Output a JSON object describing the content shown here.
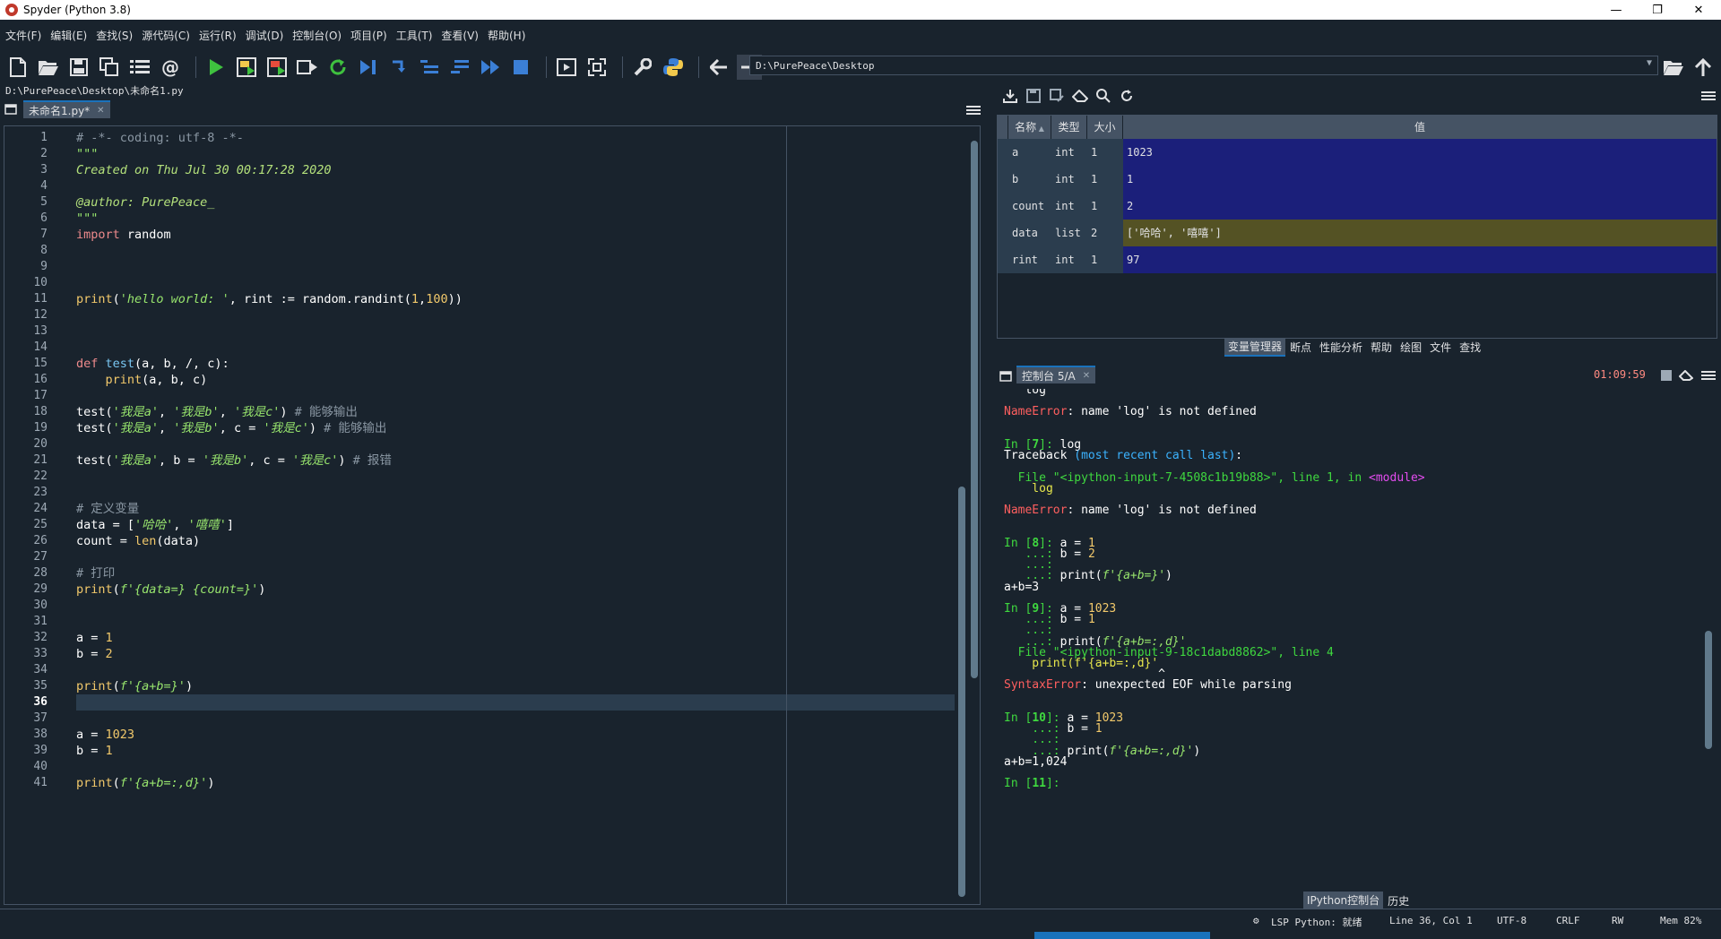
{
  "window": {
    "title": "Spyder (Python 3.8)"
  },
  "menu": [
    "文件(F)",
    "编辑(E)",
    "查找(S)",
    "源代码(C)",
    "运行(R)",
    "调试(D)",
    "控制台(O)",
    "项目(P)",
    "工具(T)",
    "查看(V)",
    "帮助(H)"
  ],
  "toolbar": {
    "path": "D:\\PurePeace\\Desktop"
  },
  "editor": {
    "file_path": "D:\\PurePeace\\Desktop\\未命名1.py",
    "tab_label": "未命名1.py*",
    "current_line": 36,
    "lines": [
      [
        {
          "t": "# -*- coding: utf-8 -*-",
          "c": "comment"
        }
      ],
      [
        {
          "t": "\"\"\"",
          "c": "str"
        }
      ],
      [
        {
          "t": "Created on Thu Jul 30 00:17:28 2020",
          "c": "doc"
        }
      ],
      [],
      [
        {
          "t": "@author: PurePeace_",
          "c": "doc"
        }
      ],
      [
        {
          "t": "\"\"\"",
          "c": "str"
        }
      ],
      [
        {
          "t": "import",
          "c": "kw"
        },
        {
          "t": " random",
          "c": "plain"
        }
      ],
      [],
      [],
      [],
      [
        {
          "t": "print",
          "c": "builtin"
        },
        {
          "t": "(",
          "c": "plain"
        },
        {
          "t": "'hello world: '",
          "c": "str"
        },
        {
          "t": ", rint := random.randint(",
          "c": "plain"
        },
        {
          "t": "1",
          "c": "num"
        },
        {
          "t": ",",
          "c": "plain"
        },
        {
          "t": "100",
          "c": "num"
        },
        {
          "t": "))",
          "c": "plain"
        }
      ],
      [],
      [],
      [],
      [
        {
          "t": "def ",
          "c": "kw"
        },
        {
          "t": "test",
          "c": "def"
        },
        {
          "t": "(a, b, /, c):",
          "c": "plain"
        }
      ],
      [
        {
          "t": "    ",
          "c": "plain"
        },
        {
          "t": "print",
          "c": "builtin"
        },
        {
          "t": "(a, b, c)",
          "c": "plain"
        }
      ],
      [],
      [
        {
          "t": "test(",
          "c": "plain"
        },
        {
          "t": "'我是a'",
          "c": "str"
        },
        {
          "t": ", ",
          "c": "plain"
        },
        {
          "t": "'我是b'",
          "c": "str"
        },
        {
          "t": ", ",
          "c": "plain"
        },
        {
          "t": "'我是c'",
          "c": "str"
        },
        {
          "t": ") ",
          "c": "plain"
        },
        {
          "t": "# 能够输出",
          "c": "comment"
        }
      ],
      [
        {
          "t": "test(",
          "c": "plain"
        },
        {
          "t": "'我是a'",
          "c": "str"
        },
        {
          "t": ", ",
          "c": "plain"
        },
        {
          "t": "'我是b'",
          "c": "str"
        },
        {
          "t": ", c = ",
          "c": "plain"
        },
        {
          "t": "'我是c'",
          "c": "str"
        },
        {
          "t": ") ",
          "c": "plain"
        },
        {
          "t": "# 能够输出",
          "c": "comment"
        }
      ],
      [],
      [
        {
          "t": "test(",
          "c": "plain"
        },
        {
          "t": "'我是a'",
          "c": "str"
        },
        {
          "t": ", b = ",
          "c": "plain"
        },
        {
          "t": "'我是b'",
          "c": "str"
        },
        {
          "t": ", c = ",
          "c": "plain"
        },
        {
          "t": "'我是c'",
          "c": "str"
        },
        {
          "t": ") ",
          "c": "plain"
        },
        {
          "t": "# 报错",
          "c": "comment"
        }
      ],
      [],
      [],
      [
        {
          "t": "# 定义变量",
          "c": "comment"
        }
      ],
      [
        {
          "t": "data = [",
          "c": "plain"
        },
        {
          "t": "'哈哈'",
          "c": "str"
        },
        {
          "t": ", ",
          "c": "plain"
        },
        {
          "t": "'嘻嘻'",
          "c": "str"
        },
        {
          "t": "]",
          "c": "plain"
        }
      ],
      [
        {
          "t": "count = ",
          "c": "plain"
        },
        {
          "t": "len",
          "c": "builtin"
        },
        {
          "t": "(data)",
          "c": "plain"
        }
      ],
      [],
      [
        {
          "t": "# 打印",
          "c": "comment"
        }
      ],
      [
        {
          "t": "print",
          "c": "builtin"
        },
        {
          "t": "(",
          "c": "plain"
        },
        {
          "t": "f'{data=} {count=}'",
          "c": "str"
        },
        {
          "t": ")",
          "c": "plain"
        }
      ],
      [],
      [],
      [
        {
          "t": "a = ",
          "c": "plain"
        },
        {
          "t": "1",
          "c": "num"
        }
      ],
      [
        {
          "t": "b = ",
          "c": "plain"
        },
        {
          "t": "2",
          "c": "num"
        }
      ],
      [],
      [
        {
          "t": "print",
          "c": "builtin"
        },
        {
          "t": "(",
          "c": "plain"
        },
        {
          "t": "f'{a+b=}'",
          "c": "str"
        },
        {
          "t": ")",
          "c": "plain"
        }
      ],
      [],
      [],
      [
        {
          "t": "a = ",
          "c": "plain"
        },
        {
          "t": "1023",
          "c": "num"
        }
      ],
      [
        {
          "t": "b = ",
          "c": "plain"
        },
        {
          "t": "1",
          "c": "num"
        }
      ],
      [],
      [
        {
          "t": "print",
          "c": "builtin"
        },
        {
          "t": "(",
          "c": "plain"
        },
        {
          "t": "f'{a+b=:,d}'",
          "c": "str"
        },
        {
          "t": ")",
          "c": "plain"
        }
      ]
    ]
  },
  "variable_explorer": {
    "headers": {
      "name": "名称",
      "type": "类型",
      "size": "大小",
      "value": "值"
    },
    "rows": [
      {
        "name": "a",
        "type": "int",
        "size": "1",
        "value": "1023",
        "color": "#1b1f7a"
      },
      {
        "name": "b",
        "type": "int",
        "size": "1",
        "value": "1",
        "color": "#1b1f7a"
      },
      {
        "name": "count",
        "type": "int",
        "size": "1",
        "value": "2",
        "color": "#1b1f7a"
      },
      {
        "name": "data",
        "type": "list",
        "size": "2",
        "value": "['哈哈', '嘻嘻']",
        "color": "#545224"
      },
      {
        "name": "rint",
        "type": "int",
        "size": "1",
        "value": "97",
        "color": "#1b1f7a"
      }
    ]
  },
  "upper_dock_tabs": [
    "变量管理器",
    "断点",
    "性能分析",
    "帮助",
    "绘图",
    "文件",
    "查找"
  ],
  "console": {
    "tab_label": "控制台 5/A",
    "elapsed": "01:09:59",
    "lines": [
      [
        {
          "t": "   log",
          "c": "white"
        }
      ],
      [
        {
          "t": "",
          "c": "white"
        }
      ],
      [
        {
          "t": "NameError",
          "c": "err"
        },
        {
          "t": ": name 'log' is not defined",
          "c": "white"
        }
      ],
      [
        {
          "t": "",
          "c": "white"
        }
      ],
      [
        {
          "t": "",
          "c": "white"
        }
      ],
      [
        {
          "t": "In [",
          "c": "prompt"
        },
        {
          "t": "7",
          "c": "promptnum"
        },
        {
          "t": "]: ",
          "c": "prompt"
        },
        {
          "t": "log",
          "c": "white"
        }
      ],
      [
        {
          "t": "Traceback ",
          "c": "white"
        },
        {
          "t": "(most recent call last)",
          "c": "cyan"
        },
        {
          "t": ":",
          "c": "white"
        }
      ],
      [
        {
          "t": "",
          "c": "white"
        }
      ],
      [
        {
          "t": "  File ",
          "c": "green"
        },
        {
          "t": "\"<ipython-input-7-4508c1b19b88>\"",
          "c": "green"
        },
        {
          "t": ", line ",
          "c": "green"
        },
        {
          "t": "1",
          "c": "green"
        },
        {
          "t": ", in ",
          "c": "green"
        },
        {
          "t": "<module>",
          "c": "magenta"
        }
      ],
      [
        {
          "t": "    log",
          "c": "yellow"
        }
      ],
      [
        {
          "t": "",
          "c": "white"
        }
      ],
      [
        {
          "t": "NameError",
          "c": "err"
        },
        {
          "t": ": name 'log' is not defined",
          "c": "white"
        }
      ],
      [
        {
          "t": "",
          "c": "white"
        }
      ],
      [
        {
          "t": "",
          "c": "white"
        }
      ],
      [
        {
          "t": "In [",
          "c": "prompt"
        },
        {
          "t": "8",
          "c": "promptnum"
        },
        {
          "t": "]: ",
          "c": "prompt"
        },
        {
          "t": "a = ",
          "c": "white"
        },
        {
          "t": "1",
          "c": "num"
        }
      ],
      [
        {
          "t": "   ...: ",
          "c": "prompt"
        },
        {
          "t": "b = ",
          "c": "white"
        },
        {
          "t": "2",
          "c": "num"
        }
      ],
      [
        {
          "t": "   ...: ",
          "c": "prompt"
        }
      ],
      [
        {
          "t": "   ...: ",
          "c": "prompt"
        },
        {
          "t": "print",
          "c": "white"
        },
        {
          "t": "(",
          "c": "white"
        },
        {
          "t": "f'{a+b=}'",
          "c": "str"
        },
        {
          "t": ")",
          "c": "white"
        }
      ],
      [
        {
          "t": "a+b=3",
          "c": "white"
        }
      ],
      [
        {
          "t": "",
          "c": "white"
        }
      ],
      [
        {
          "t": "In [",
          "c": "prompt"
        },
        {
          "t": "9",
          "c": "promptnum"
        },
        {
          "t": "]: ",
          "c": "prompt"
        },
        {
          "t": "a = ",
          "c": "white"
        },
        {
          "t": "1023",
          "c": "num"
        }
      ],
      [
        {
          "t": "   ...: ",
          "c": "prompt"
        },
        {
          "t": "b = ",
          "c": "white"
        },
        {
          "t": "1",
          "c": "num"
        }
      ],
      [
        {
          "t": "   ...: ",
          "c": "prompt"
        }
      ],
      [
        {
          "t": "   ...: ",
          "c": "prompt"
        },
        {
          "t": "print",
          "c": "white"
        },
        {
          "t": "(",
          "c": "white"
        },
        {
          "t": "f'{a+b=:,d}'",
          "c": "str"
        }
      ],
      [
        {
          "t": "  File ",
          "c": "green"
        },
        {
          "t": "\"<ipython-input-9-18c1dabd8862>\"",
          "c": "green"
        },
        {
          "t": ", line ",
          "c": "green"
        },
        {
          "t": "4",
          "c": "green"
        }
      ],
      [
        {
          "t": "    print(f'{a+b=:,d}'",
          "c": "yellow"
        }
      ],
      [
        {
          "t": "                      ^",
          "c": "white"
        }
      ],
      [
        {
          "t": "SyntaxError",
          "c": "err"
        },
        {
          "t": ": unexpected EOF while parsing",
          "c": "white"
        }
      ],
      [
        {
          "t": "",
          "c": "white"
        }
      ],
      [
        {
          "t": "",
          "c": "white"
        }
      ],
      [
        {
          "t": "In [",
          "c": "prompt"
        },
        {
          "t": "10",
          "c": "promptnum"
        },
        {
          "t": "]: ",
          "c": "prompt"
        },
        {
          "t": "a = ",
          "c": "white"
        },
        {
          "t": "1023",
          "c": "num"
        }
      ],
      [
        {
          "t": "    ...: ",
          "c": "prompt"
        },
        {
          "t": "b = ",
          "c": "white"
        },
        {
          "t": "1",
          "c": "num"
        }
      ],
      [
        {
          "t": "    ...: ",
          "c": "prompt"
        }
      ],
      [
        {
          "t": "    ...: ",
          "c": "prompt"
        },
        {
          "t": "print",
          "c": "white"
        },
        {
          "t": "(",
          "c": "white"
        },
        {
          "t": "f'{a+b=:,d}'",
          "c": "str"
        },
        {
          "t": ")",
          "c": "white"
        }
      ],
      [
        {
          "t": "a+b=1,024",
          "c": "white"
        }
      ],
      [
        {
          "t": "",
          "c": "white"
        }
      ],
      [
        {
          "t": "In [",
          "c": "prompt"
        },
        {
          "t": "11",
          "c": "promptnum"
        },
        {
          "t": "]: ",
          "c": "prompt"
        }
      ]
    ]
  },
  "lower_dock_tabs": [
    "IPython控制台",
    "历史"
  ],
  "status": {
    "lsp": "LSP Python: 就绪",
    "position": "Line 36, Col 1",
    "encoding": "UTF-8",
    "eol": "CRLF",
    "perm": "RW",
    "mem": "Mem 82%"
  },
  "colors": {
    "comment": "#8a97a3",
    "str": "#98e56d",
    "doc": "#b3e07b",
    "kw": "#ed8a8c",
    "builtin": "#f2c96b",
    "def": "#79c7f2",
    "num": "#f2c96b",
    "plain": "#ffffff",
    "white": "#ffffff",
    "err": "#ff5f5f",
    "prompt": "#3fd83f",
    "promptnum": "#3fd83f",
    "green": "#3fd83f",
    "cyan": "#3bb3ff",
    "magenta": "#e44cf0",
    "yellow": "#e6e64c"
  }
}
